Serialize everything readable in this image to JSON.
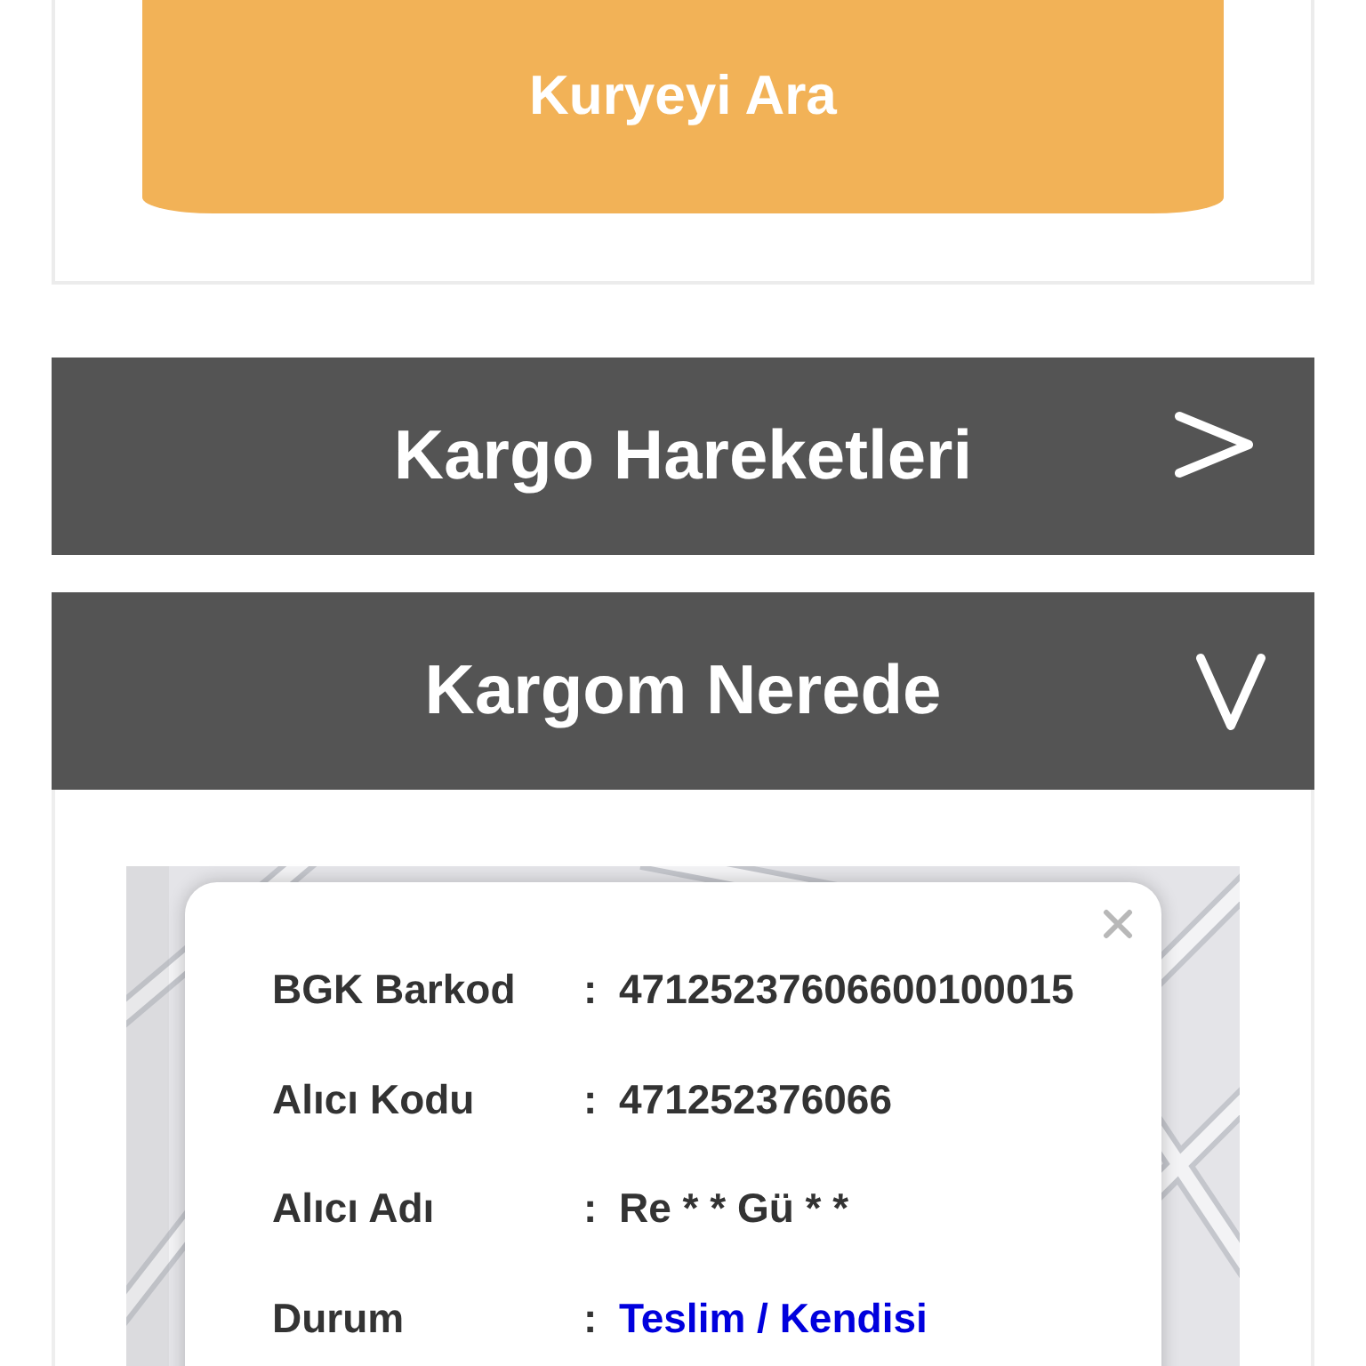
{
  "call_button": {
    "label": "Kuryeyi Ara"
  },
  "accordions": [
    {
      "title": "Kargo Hareketleri",
      "expanded": false
    },
    {
      "title": "Kargom Nerede",
      "expanded": true,
      "info_popup": {
        "rows": [
          {
            "label": "BGK Barkod",
            "separator": ":",
            "value": "47125237606600100015",
            "kind": "plain"
          },
          {
            "label": "Alıcı Kodu",
            "separator": ":",
            "value": "471252376066",
            "kind": "plain"
          },
          {
            "label": "Alıcı Adı",
            "separator": ":",
            "value": "Re * * Gü * *",
            "kind": "plain"
          },
          {
            "label": "Durum",
            "separator": ":",
            "value": "Teslim / Kendisi",
            "kind": "status"
          }
        ]
      }
    }
  ]
}
